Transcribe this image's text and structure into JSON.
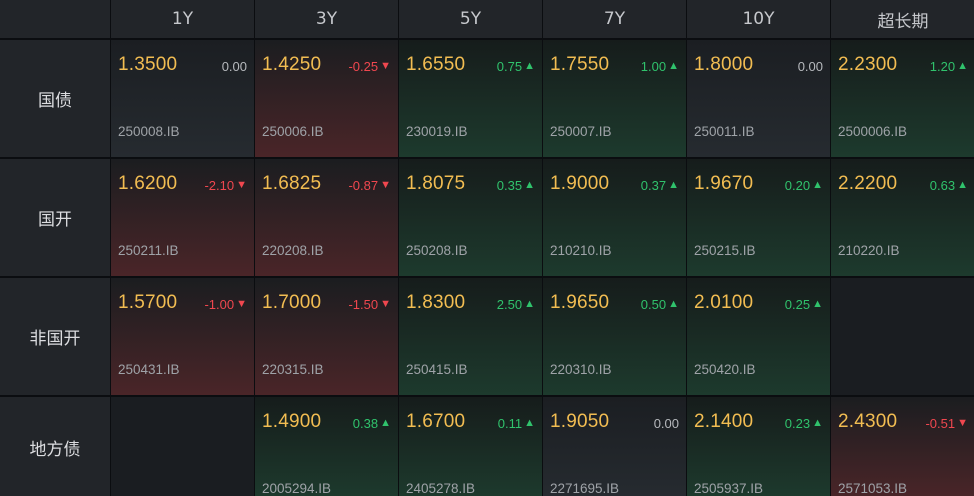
{
  "header": {
    "columns": [
      "1Y",
      "3Y",
      "5Y",
      "7Y",
      "10Y",
      "超长期"
    ]
  },
  "rows": [
    {
      "label": "国债",
      "cells": [
        {
          "yield": "1.3500",
          "change": "0.00",
          "dir": "zero",
          "code": "250008.IB"
        },
        {
          "yield": "1.4250",
          "change": "-0.25",
          "dir": "neg",
          "code": "250006.IB"
        },
        {
          "yield": "1.6550",
          "change": "0.75",
          "dir": "pos",
          "code": "230019.IB"
        },
        {
          "yield": "1.7550",
          "change": "1.00",
          "dir": "pos",
          "code": "250007.IB"
        },
        {
          "yield": "1.8000",
          "change": "0.00",
          "dir": "zero",
          "code": "250011.IB"
        },
        {
          "yield": "2.2300",
          "change": "1.20",
          "dir": "pos",
          "code": "2500006.IB"
        }
      ]
    },
    {
      "label": "国开",
      "cells": [
        {
          "yield": "1.6200",
          "change": "-2.10",
          "dir": "neg",
          "code": "250211.IB"
        },
        {
          "yield": "1.6825",
          "change": "-0.87",
          "dir": "neg",
          "code": "220208.IB"
        },
        {
          "yield": "1.8075",
          "change": "0.35",
          "dir": "pos",
          "code": "250208.IB"
        },
        {
          "yield": "1.9000",
          "change": "0.37",
          "dir": "pos",
          "code": "210210.IB"
        },
        {
          "yield": "1.9670",
          "change": "0.20",
          "dir": "pos",
          "code": "250215.IB"
        },
        {
          "yield": "2.2200",
          "change": "0.63",
          "dir": "pos",
          "code": "210220.IB"
        }
      ]
    },
    {
      "label": "非国开",
      "cells": [
        {
          "yield": "1.5700",
          "change": "-1.00",
          "dir": "neg",
          "code": "250431.IB"
        },
        {
          "yield": "1.7000",
          "change": "-1.50",
          "dir": "neg",
          "code": "220315.IB"
        },
        {
          "yield": "1.8300",
          "change": "2.50",
          "dir": "pos",
          "code": "250415.IB"
        },
        {
          "yield": "1.9650",
          "change": "0.50",
          "dir": "pos",
          "code": "220310.IB"
        },
        {
          "yield": "2.0100",
          "change": "0.25",
          "dir": "pos",
          "code": "250420.IB"
        },
        null
      ]
    },
    {
      "label": "地方债",
      "cells": [
        null,
        {
          "yield": "1.4900",
          "change": "0.38",
          "dir": "pos",
          "code": "2005294.IB"
        },
        {
          "yield": "1.6700",
          "change": "0.11",
          "dir": "pos",
          "code": "2405278.IB"
        },
        {
          "yield": "1.9050",
          "change": "0.00",
          "dir": "zero",
          "code": "2271695.IB"
        },
        {
          "yield": "2.1400",
          "change": "0.23",
          "dir": "pos",
          "code": "2505937.IB"
        },
        {
          "yield": "2.4300",
          "change": "-0.51",
          "dir": "neg",
          "code": "2571053.IB"
        }
      ]
    }
  ],
  "icons": {
    "up": "triangle-up-icon",
    "down": "triangle-down-icon"
  },
  "colors": {
    "yield": "#f2bd52",
    "up": "#30c26c",
    "down": "#f0474f",
    "neutral": "#b6b9bd"
  }
}
